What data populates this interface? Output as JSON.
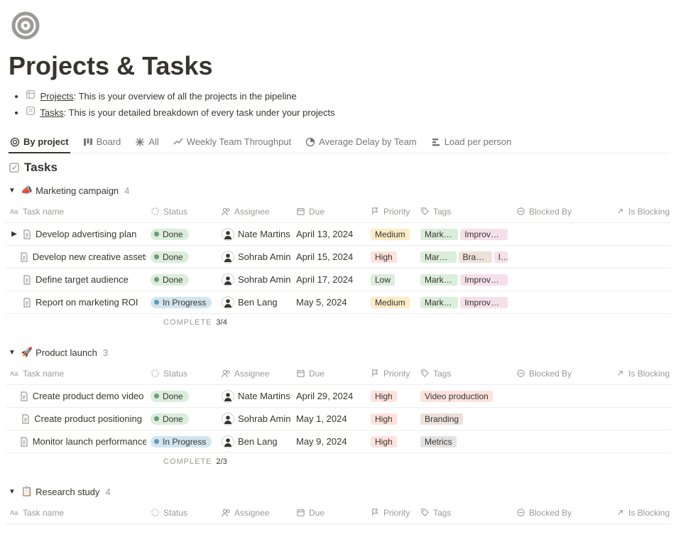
{
  "page_title": "Projects & Tasks",
  "intro": [
    {
      "link": "Projects",
      "desc": ": This is your overview of all the projects in the pipeline"
    },
    {
      "link": "Tasks",
      "desc": ": This is your detailed breakdown of every task under your projects"
    }
  ],
  "tabs": [
    "By project",
    "Board",
    "All",
    "Weekly Team Throughput",
    "Average Delay by Team",
    "Load per person"
  ],
  "db_title": "Tasks",
  "columns": {
    "name": "Task name",
    "status": "Status",
    "assignee": "Assignee",
    "due": "Due",
    "priority": "Priority",
    "tags": "Tags",
    "blocked_by": "Blocked By",
    "is_blocking": "Is Blocking"
  },
  "complete_label": "COMPLETE",
  "groups": [
    {
      "emoji": "📣",
      "name": "Marketing campaign",
      "count": "4",
      "complete": "3/4",
      "rows": [
        {
          "expandable": true,
          "name": "Develop advertising plan",
          "status": "Done",
          "assignee": "Nate Martins",
          "due": "April 13, 2024",
          "priority": "Medium",
          "tags": [
            "Marketing",
            "Improvement"
          ]
        },
        {
          "expandable": false,
          "name": "Develop new creative assets",
          "status": "Done",
          "assignee": "Sohrab Amin",
          "due": "April 15, 2024",
          "priority": "High",
          "tags": [
            "Marketing",
            "Branding",
            "In"
          ]
        },
        {
          "expandable": false,
          "name": "Define target audience",
          "status": "Done",
          "assignee": "Sohrab Amin",
          "due": "April 17, 2024",
          "priority": "Low",
          "tags": [
            "Marketing",
            "Improvement"
          ]
        },
        {
          "expandable": false,
          "name": "Report on marketing ROI",
          "status": "In Progress",
          "assignee": "Ben Lang",
          "due": "May 5, 2024",
          "priority": "Medium",
          "tags": [
            "Marketing",
            "Improvement"
          ]
        }
      ]
    },
    {
      "emoji": "🚀",
      "name": "Product launch",
      "count": "3",
      "complete": "2/3",
      "rows": [
        {
          "expandable": false,
          "name": "Create product demo video",
          "status": "Done",
          "assignee": "Nate Martins",
          "due": "April 29, 2024",
          "priority": "High",
          "tags": [
            "Video production"
          ]
        },
        {
          "expandable": false,
          "name": "Create product positioning",
          "status": "Done",
          "assignee": "Sohrab Amin",
          "due": "May 1, 2024",
          "priority": "High",
          "tags": [
            "Branding"
          ]
        },
        {
          "expandable": false,
          "name": "Monitor launch performance",
          "status": "In Progress",
          "assignee": "Ben Lang",
          "due": "May 9, 2024",
          "priority": "High",
          "tags": [
            "Metrics"
          ]
        }
      ]
    },
    {
      "emoji": "📋",
      "name": "Research study",
      "count": "4",
      "complete": null,
      "rows": []
    }
  ]
}
